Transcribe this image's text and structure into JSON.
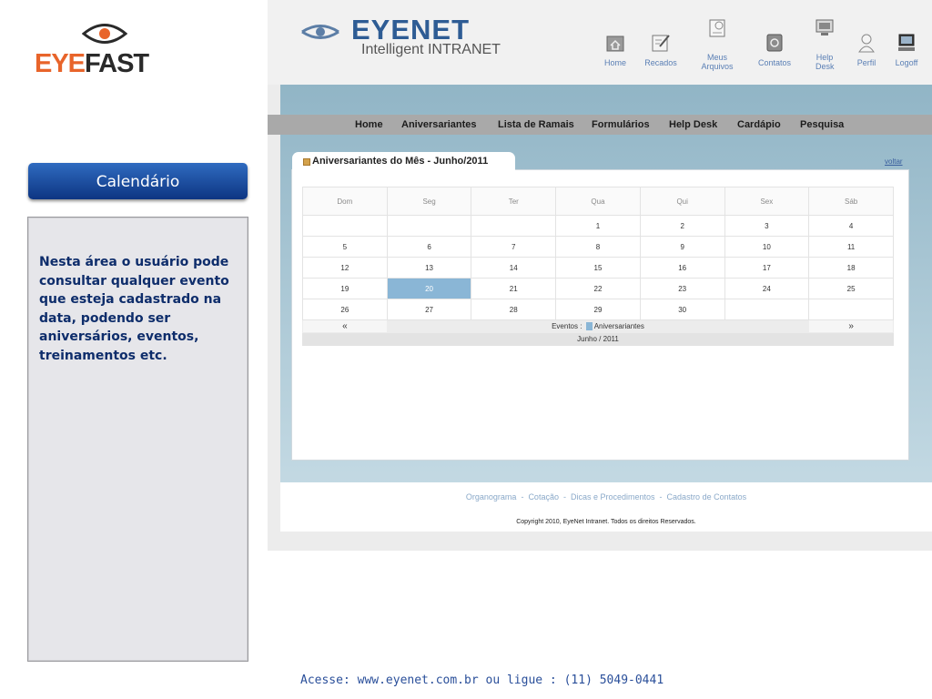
{
  "slide": {
    "logo": {
      "text_a": "EYE",
      "text_b": "FAST"
    },
    "section_title": "Calendário",
    "description": "Nesta área o usuário pode consultar qualquer evento que esteja cadastrado na data, podendo ser aniversários, eventos, treinamentos etc.",
    "footer": "Acesse: www.eyenet.com.br ou ligue : (11) 5049-0441"
  },
  "app": {
    "brand_name": "EYENET",
    "brand_sub": "Intelligent INTRANET",
    "toolbar": [
      {
        "label": "Home",
        "icon": "home-icon"
      },
      {
        "label": "Recados",
        "icon": "notepad-icon"
      },
      {
        "label": "Meus Arquivos",
        "icon": "files-icon"
      },
      {
        "label": "Contatos",
        "icon": "contacts-icon"
      },
      {
        "label": "Help Desk",
        "icon": "monitor-icon"
      },
      {
        "label": "Perfil",
        "icon": "user-icon"
      },
      {
        "label": "Logoff",
        "icon": "computer-icon"
      }
    ],
    "nav": [
      "Home",
      "Aniversariantes",
      "Lista de Ramais",
      "Formulários",
      "Help Desk",
      "Cardápio",
      "Pesquisa"
    ],
    "panel_title": "Aniversariantes do Mês - Junho/2011",
    "back_link": "voltar",
    "calendar": {
      "weekdays": [
        "Dom",
        "Seg",
        "Ter",
        "Qua",
        "Qui",
        "Sex",
        "Sáb"
      ],
      "weeks": [
        [
          "",
          "",
          "",
          "1",
          "2",
          "3",
          "4"
        ],
        [
          "5",
          "6",
          "7",
          "8",
          "9",
          "10",
          "11"
        ],
        [
          "12",
          "13",
          "14",
          "15",
          "16",
          "17",
          "18"
        ],
        [
          "19",
          "20",
          "21",
          "22",
          "23",
          "24",
          "25"
        ],
        [
          "26",
          "27",
          "28",
          "29",
          "30",
          "",
          ""
        ]
      ],
      "highlighted_day": "20",
      "prev_label": "«",
      "next_label": "»",
      "legend_prefix": "Eventos :",
      "legend_label": "Aniversariantes",
      "month_label": "Junho / 2011",
      "highlight_color": "#8ab6d6"
    },
    "footer_links": [
      "Organograma",
      "Cotação",
      "Dicas e Procedimentos",
      "Cadastro de Contatos"
    ],
    "copyright": "Copyright 2010, EyeNet Intranet. Todos os direitos Reservados."
  }
}
